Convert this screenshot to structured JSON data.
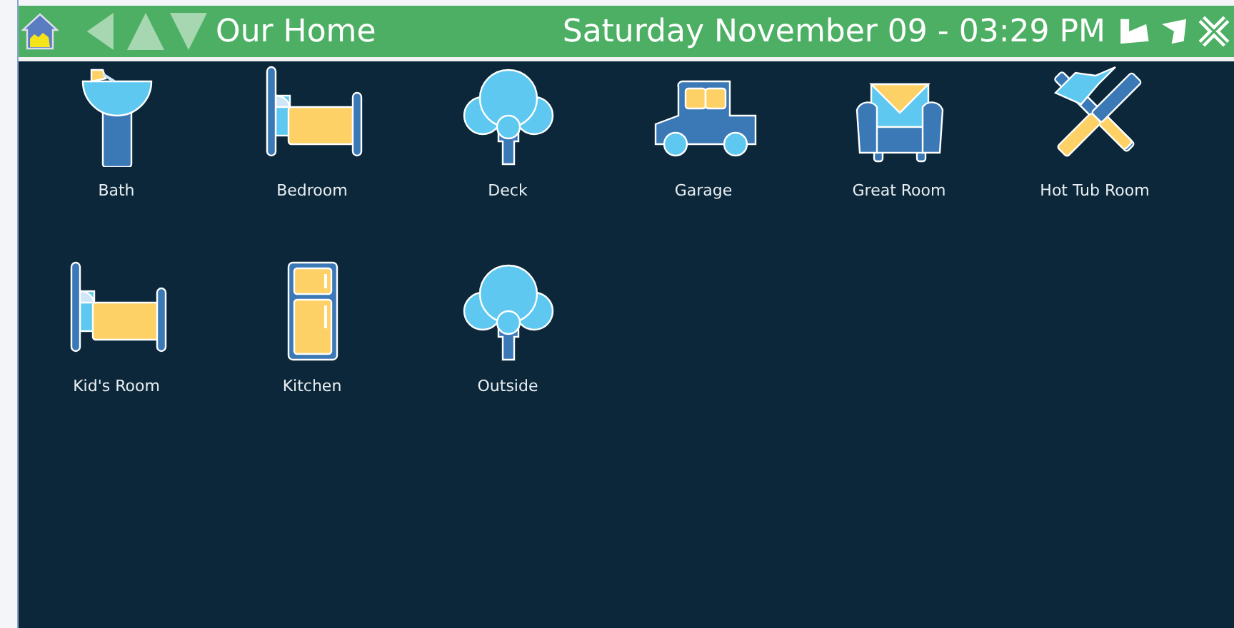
{
  "header": {
    "nav_buttons": [
      {
        "kind": "back",
        "disabled": true
      },
      {
        "kind": "up",
        "disabled": true
      },
      {
        "kind": "down",
        "disabled": true
      }
    ],
    "title": "Our Home",
    "datetime": "Saturday November 09 - 03:29 PM"
  },
  "rooms": [
    {
      "label": "Bath",
      "kind": "sink"
    },
    {
      "label": "Bedroom",
      "kind": "bed"
    },
    {
      "label": "Deck",
      "kind": "tree"
    },
    {
      "label": "Garage",
      "kind": "car"
    },
    {
      "label": "Great Room",
      "kind": "sofa"
    },
    {
      "label": "Hot Tub Room",
      "kind": "tools"
    },
    {
      "label": "Kid's Room",
      "kind": "bed"
    },
    {
      "label": "Kitchen",
      "kind": "fridge"
    },
    {
      "label": "Outside",
      "kind": "tree"
    }
  ]
}
